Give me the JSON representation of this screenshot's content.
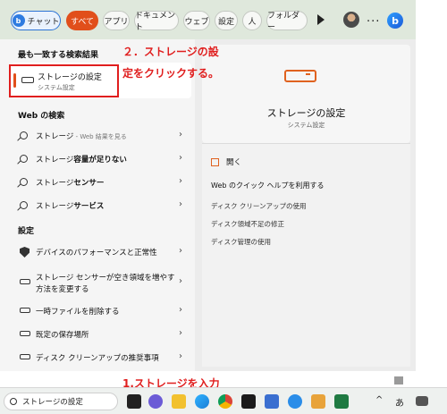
{
  "filters": {
    "chat": "チャット",
    "chat_badge": "b",
    "all": "すべて",
    "apps": "アプリ",
    "documents": "ドキュメント",
    "web": "ウェブ",
    "settings": "設定",
    "people": "人",
    "folders": "フォルダー",
    "more": "...",
    "bing": "b"
  },
  "left": {
    "best_match_header": "最も一致する検索結果",
    "best_match": {
      "title": "ストレージの設定",
      "subtitle": "システム設定"
    },
    "web_header": "Web の検索",
    "web_results": [
      {
        "prefix": "ストレージ",
        "bold": "",
        "suffix": " - Web 結果を見る"
      },
      {
        "prefix": "ストレージ",
        "bold": "容量が足りない",
        "suffix": ""
      },
      {
        "prefix": "ストレージ",
        "bold": "センサー",
        "suffix": ""
      },
      {
        "prefix": "ストレージ",
        "bold": "サービス",
        "suffix": ""
      }
    ],
    "settings_header": "設定",
    "settings_results": [
      {
        "label": "デバイスのパフォーマンスと正常性"
      },
      {
        "label": "ストレージ センサーが空き領域を増やす",
        "label2": "方法を変更する"
      },
      {
        "label": "一時ファイルを削除する"
      },
      {
        "label": "既定の保存場所"
      },
      {
        "label": "ディスク クリーンアップの推奨事項"
      }
    ]
  },
  "right": {
    "title": "ストレージの設定",
    "subtitle": "システム設定",
    "open": "開く",
    "web_help": "Web のクイック ヘルプを利用する",
    "links": [
      "ディスク クリーンアップの使用",
      "ディスク領域不足の修正",
      "ディスク管理の使用"
    ]
  },
  "annotations": {
    "step2_line1": "２．ストレージの設",
    "step2_line2": "定をクリックする。",
    "step1": "1.ストレージを入力"
  },
  "taskbar": {
    "search_text": "ストレージの設定",
    "tray_chevron": "^",
    "ime": "あ"
  },
  "colors": {
    "accent": "#e14f1b",
    "annotation": "#e01e1e",
    "filterbar_bg": "#dfe8dc"
  }
}
